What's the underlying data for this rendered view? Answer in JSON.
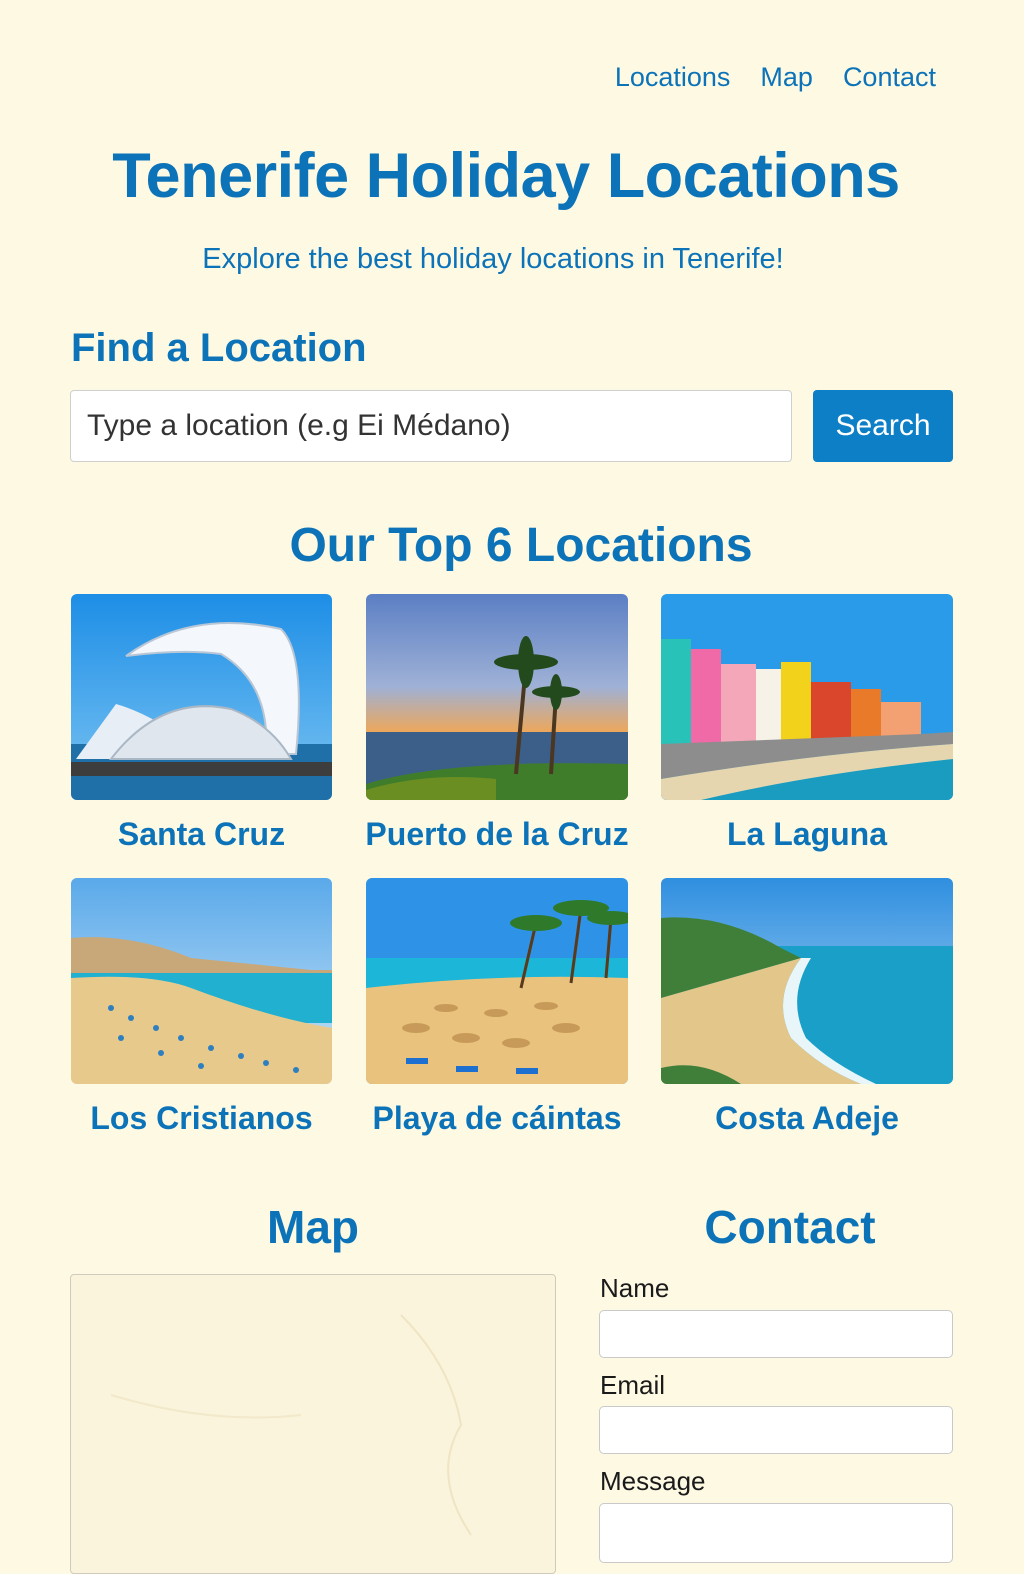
{
  "nav": {
    "items": [
      {
        "label": "Locations"
      },
      {
        "label": "Map"
      },
      {
        "label": "Contact"
      }
    ]
  },
  "header": {
    "title": "Tenerife Holiday Locations",
    "subtitle": "Explore the best holiday locations in Tenerife!"
  },
  "search": {
    "heading": "Find a Location",
    "placeholder": "Type a location (e.g Ei Médano)",
    "button_label": "Search"
  },
  "locations": {
    "heading": "Our Top 6 Locations",
    "items": [
      {
        "name": "Santa Cruz",
        "image": "auditorium-photo"
      },
      {
        "name": "Puerto de la Cruz",
        "image": "palm-sunset-photo"
      },
      {
        "name": "La Laguna",
        "image": "colorful-houses-photo"
      },
      {
        "name": "Los Cristianos",
        "image": "beach-umbrellas-photo"
      },
      {
        "name": "Playa de cáintas",
        "image": "palm-beach-photo"
      },
      {
        "name": "Costa Adeje",
        "image": "coastline-photo"
      }
    ]
  },
  "map": {
    "heading": "Map"
  },
  "contact": {
    "heading": "Contact",
    "fields": [
      {
        "label": "Name",
        "value": ""
      },
      {
        "label": "Email",
        "value": ""
      },
      {
        "label": "Message",
        "value": ""
      }
    ]
  },
  "colors": {
    "background": "#fdf9e3",
    "accent": "#0d73b8",
    "button": "#0d7fc6"
  }
}
